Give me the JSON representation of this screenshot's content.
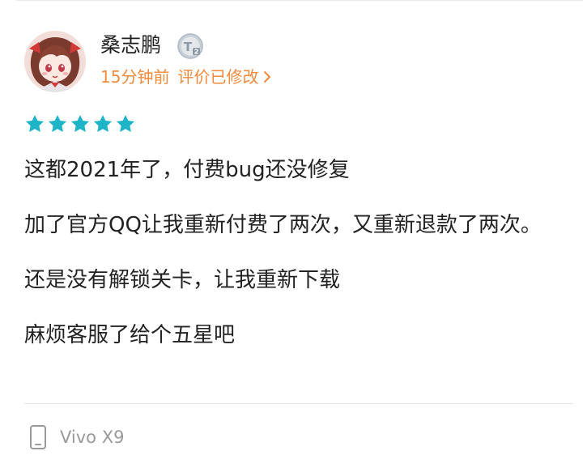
{
  "user": {
    "name": "桑志鹏",
    "level_badge": "T2"
  },
  "meta": {
    "time": "15分钟前",
    "edited": "评价已修改"
  },
  "rating": {
    "stars": 5,
    "max": 5,
    "color": "#1eb4c8"
  },
  "review": {
    "paragraphs": [
      "这都2021年了，付费bug还没修复",
      "加了官方QQ让我重新付费了两次，又重新退款了两次。",
      "还是没有解锁关卡，让我重新下载",
      "麻烦客服了给个五星吧"
    ]
  },
  "device": {
    "name": "Vivo X9"
  },
  "colors": {
    "meta_accent": "#f08a3d",
    "text": "#222222",
    "muted": "#9a9a9a"
  }
}
